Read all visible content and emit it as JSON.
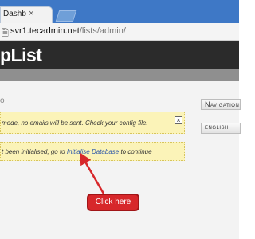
{
  "browser": {
    "tab_title": "Dashb",
    "tab_close": "×",
    "address_host": "svr1.tecadmin.net",
    "address_path": "/lists/admin/"
  },
  "app": {
    "title": "pList",
    "stray_char": "o"
  },
  "alerts": {
    "test_mode": "mode, no emails will be sent. Check your config file.",
    "close_glyph": "×",
    "db_prefix": "t been initialised, go to ",
    "db_link": "Initialise Database",
    "db_suffix": " to continue"
  },
  "sidebar": {
    "navigation_label": "Navigation",
    "language_label": "ENGLISH"
  },
  "annotation": {
    "callout_text": "Click here"
  },
  "colors": {
    "window_border": "#3c78c8",
    "header_dark": "#2b2b2b",
    "alert_bg": "#fbf3b8",
    "callout_red": "#d7272a"
  }
}
